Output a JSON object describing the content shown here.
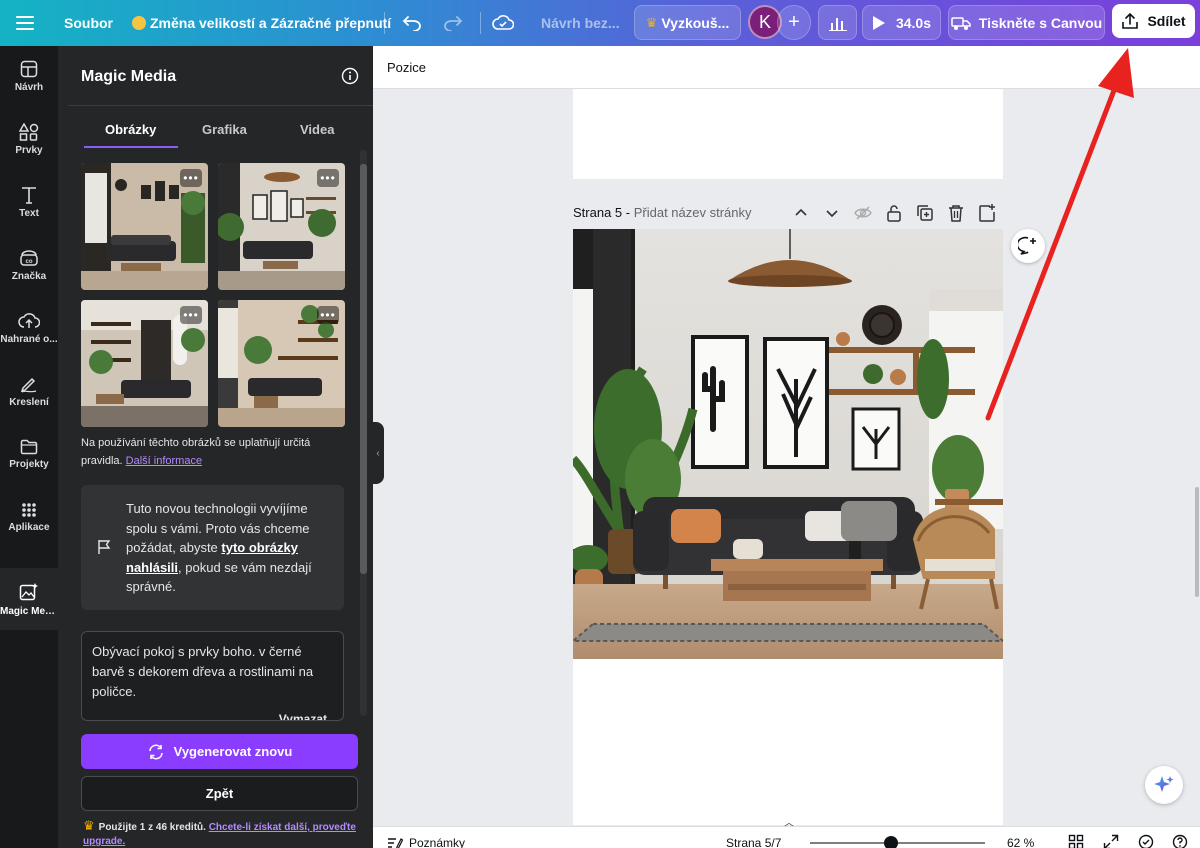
{
  "topbar": {
    "menu_icon": "hamburger-icon",
    "file_label": "Soubor",
    "resize_label": "Změna velikostí a Zázračné přepnutí",
    "design_name": "Návrh bez...",
    "try_label": "Vyzkouš...",
    "avatar_letter": "K",
    "timer_label": "34.0s",
    "print_label": "Tiskněte s Canvou",
    "share_label": "Sdílet"
  },
  "rail": {
    "items": [
      {
        "label": "Návrh",
        "icon": "layout-icon"
      },
      {
        "label": "Prvky",
        "icon": "shapes-icon"
      },
      {
        "label": "Text",
        "icon": "text-icon"
      },
      {
        "label": "Značka",
        "icon": "brand-icon"
      },
      {
        "label": "Nahrané o...",
        "icon": "cloud-upload-icon"
      },
      {
        "label": "Kreslení",
        "icon": "draw-icon"
      },
      {
        "label": "Projekty",
        "icon": "folder-icon"
      },
      {
        "label": "Aplikace",
        "icon": "apps-grid-icon"
      },
      {
        "label": "Magic Med...",
        "icon": "magic-media-icon"
      }
    ]
  },
  "panel": {
    "title": "Magic Media",
    "tabs": [
      "Obrázky",
      "Grafika",
      "Videa"
    ],
    "active_tab": "Obrázky",
    "notice_text": "Na používání těchto obrázků se uplatňují určitá pravidla.",
    "notice_link": "Další informace",
    "feedback_pre": "Tuto novou technologii vyvíjíme spolu s vámi. Proto vás chceme požádat, abyste",
    "feedback_bold": "tyto obrázky nahlásili",
    "feedback_post": ", pokud se vám nezdají správné.",
    "prompt_text": "Obývací pokoj s prvky boho. v černé barvě s dekorem dřeva a rostlinami na poličce.",
    "clear_label": "Vymazat",
    "regenerate_label": "Vygenerovat znovu",
    "back_label": "Zpět",
    "credits_text": "Použijte 1 z 46 kreditů.",
    "credits_link": "Chcete-li získat další, proveďte upgrade."
  },
  "canvas": {
    "subbar_label": "Pozice",
    "page_label": "Strana 5 -",
    "page_title_placeholder": "Přidat název stránky"
  },
  "bottombar": {
    "notes_label": "Poznámky",
    "page_indicator": "Strana 5/7",
    "zoom_label": "62 %",
    "zoom_value": 62
  },
  "colors": {
    "accent": "#8b3dff",
    "annotation_arrow": "#e8231f"
  }
}
